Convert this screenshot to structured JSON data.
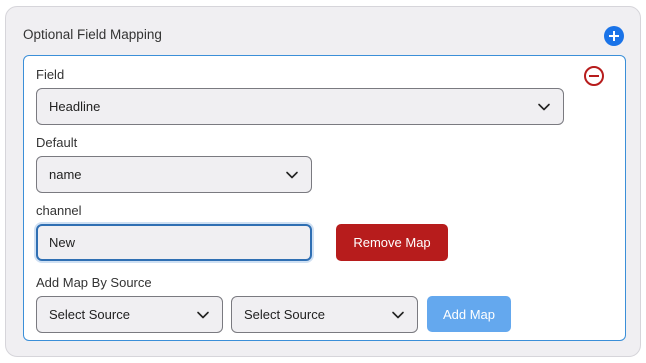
{
  "section": {
    "title": "Optional Field Mapping",
    "add_icon": "plus-circle-icon",
    "accent_color": "#1a73e8"
  },
  "mapping": {
    "remove_icon": "minus-circle-icon",
    "field": {
      "label": "Field",
      "value": "Headline"
    },
    "default": {
      "label": "Default",
      "value": "name"
    },
    "channel": {
      "label": "channel",
      "value": "New"
    },
    "remove_button": "Remove Map",
    "add_by_source": {
      "label": "Add Map By Source",
      "source_1": "Select Source",
      "source_2": "Select Source",
      "add_button": "Add Map"
    }
  },
  "colors": {
    "danger": "#b71c1c",
    "primary_light": "#64a8ee",
    "border_active": "#3b8fd8"
  }
}
